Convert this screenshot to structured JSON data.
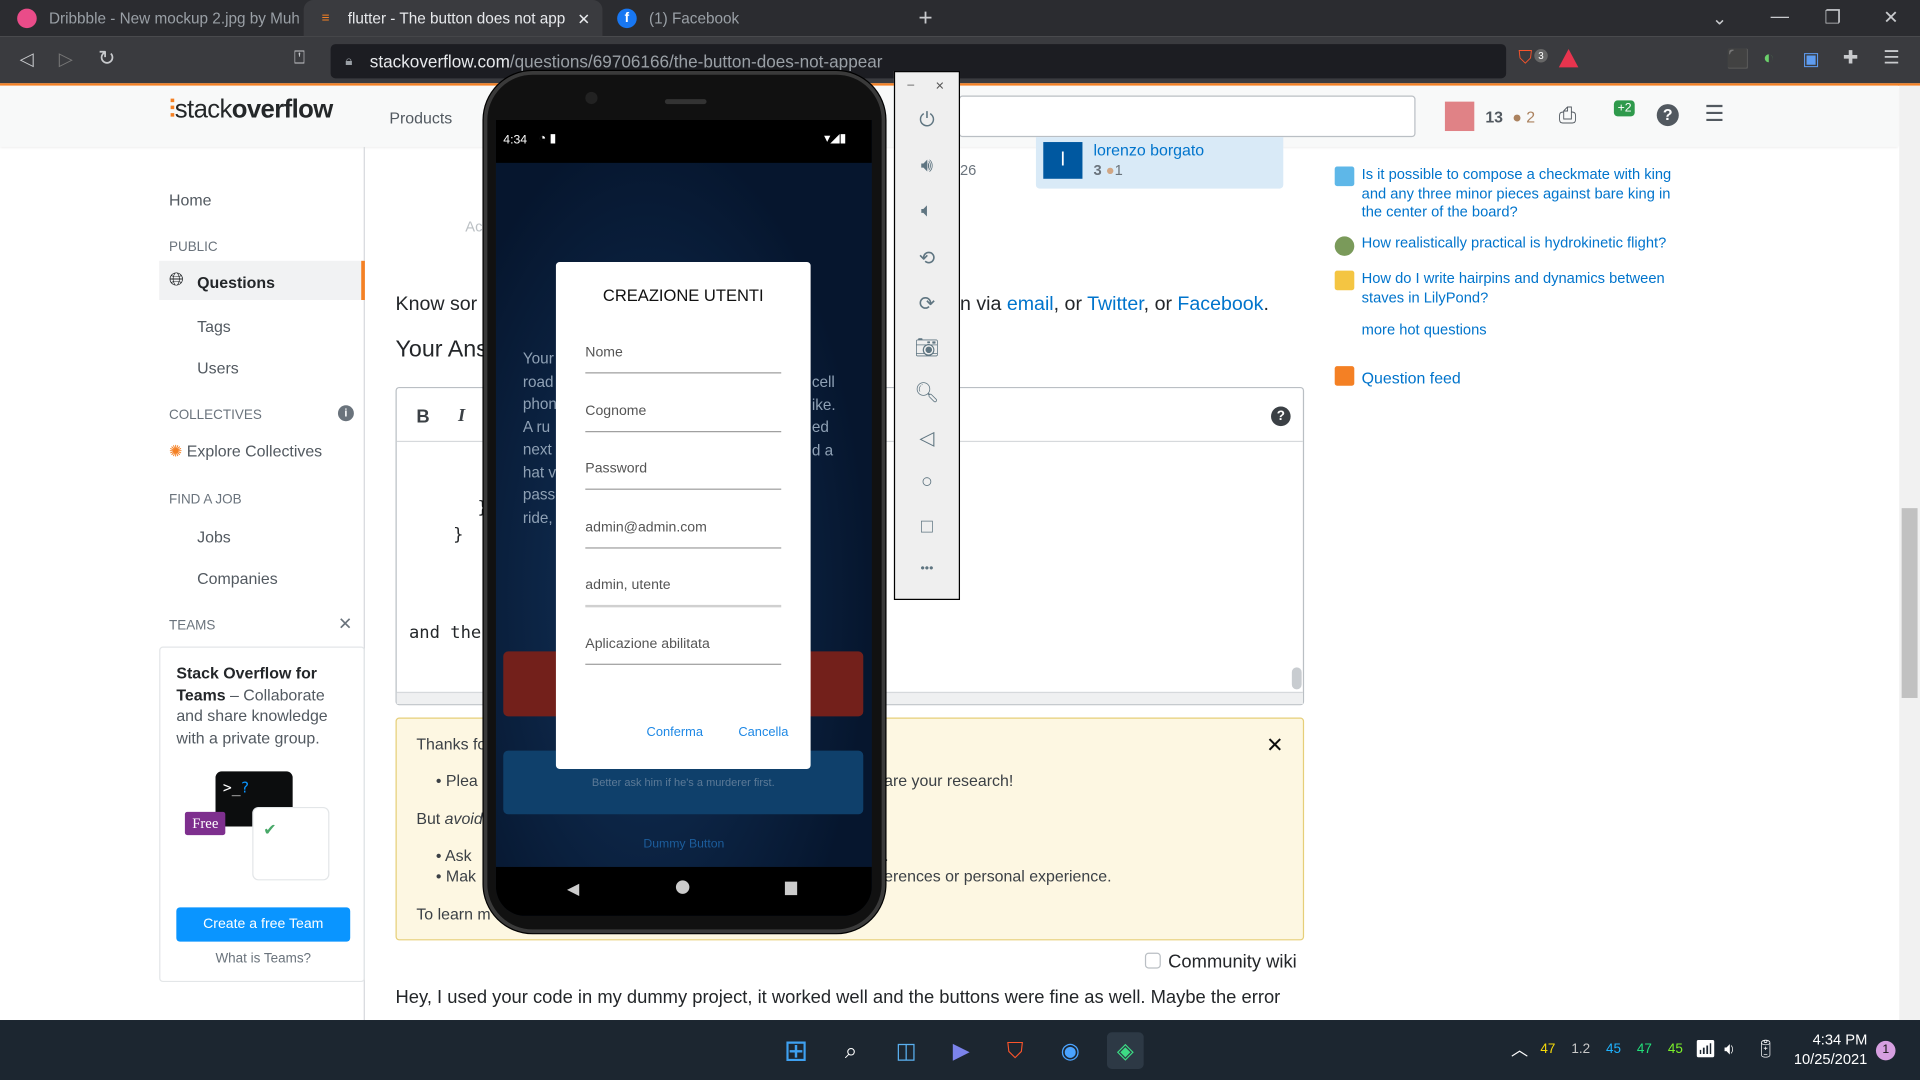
{
  "browser": {
    "tabs": [
      {
        "label": "Dribbble - New mockup 2.jpg by Muh",
        "icon": "dribbble-icon",
        "color": "#ea4c89"
      },
      {
        "label": "flutter - The button does not app",
        "icon": "stackoverflow-icon",
        "active": true
      },
      {
        "label": "(1) Facebook",
        "icon": "facebook-icon",
        "color": "#1877f2"
      }
    ],
    "new_tab": "+",
    "close_tab": "✕",
    "url_host": "stackoverflow.com",
    "url_path": "/questions/69706166/the-button-does-not-appear",
    "brave_badge": "3"
  },
  "so": {
    "logo_a": "stack",
    "logo_b": "overflow",
    "products": "Products",
    "reputation": "13",
    "bronze": "2",
    "review_badge": "+2",
    "sidebar": {
      "home": "Home",
      "public": "PUBLIC",
      "questions": "Questions",
      "tags": "Tags",
      "users": "Users",
      "collectives": "COLLECTIVES",
      "explore": "Explore Collectives",
      "find_job": "FIND A JOB",
      "jobs": "Jobs",
      "companies": "Companies",
      "teams": "TEAMS",
      "teams_title": "Stack Overflow for Teams",
      "teams_desc": " – Collaborate and share knowledge with a private group.",
      "free": "Free",
      "create_team": "Create a free Team",
      "what_is": "What is Teams?"
    },
    "user_card": {
      "initial": "l",
      "name": "lorenzo borgato",
      "rep": "3",
      "bronze": "1"
    },
    "partial_count": "26",
    "partial_ad": "Ac",
    "share_prefix": "Know sor",
    "share_suffix": "n via ",
    "share_email": "email",
    "share_twitter": "Twitter",
    "share_or": ", or ",
    "share_facebook": "Facebook",
    "share_end": ".",
    "your_answer": "Your Ans",
    "editor": {
      "bold": "B",
      "italic": "I",
      "help": "?",
      "code": [
        "}",
        "}"
      ],
      "text": "and the"
    },
    "notice": {
      "thanks": "Thanks fo",
      "bullet1_a": "Plea",
      "bullet1_b": "are your research!",
      "but": "But ",
      "avoid": "avoid",
      "bullet2": "Ask",
      "bullet2_end": ".",
      "bullet3": "Mak",
      "bullet3_b": "erences or personal experience.",
      "learn": "To learn m",
      "close": "✕"
    },
    "community_wiki": "Community wiki",
    "answer_text": "Hey, I used your code in my dummy project, it worked well and the buttons were fine as well. Maybe the error",
    "hot": [
      {
        "text": "Is it possible to compose a checkmate with king and any three minor pieces against bare king in the center of the board?",
        "color": "#5eb7e8"
      },
      {
        "text": "How realistically practical is hydrokinetic flight?",
        "color": "#7a9a5a"
      },
      {
        "text": "How do I write hairpins and dynamics between staves in LilyPond?",
        "color": "#f4c542"
      }
    ],
    "more_hot": "more hot questions",
    "feed": "Question feed"
  },
  "phone": {
    "time": "4:34",
    "bg_text": [
      "Your",
      "road",
      "phon",
      "A ru",
      "next",
      "hat v",
      "pass",
      "ride,"
    ],
    "bg_text_right": [
      "cell",
      "ike.",
      "ed",
      "d a"
    ],
    "dialog": {
      "title": "CREAZIONE UTENTI",
      "fields": [
        "Nome",
        "Cognome",
        "Password",
        "admin@admin.com",
        "admin, utente",
        "Aplicazione abilitata"
      ],
      "confirm": "Conferma",
      "cancel": "Cancella"
    },
    "blue_card_text": "Better ask him if he's a murderer first.",
    "dummy_button": "Dummy Button"
  },
  "emulator": {
    "minimize": "–",
    "close": "×",
    "more": "•••"
  },
  "taskbar": {
    "tray": [
      {
        "v": "47",
        "c": "#f5d90a"
      },
      {
        "v": "1.2",
        "c": "#c8c8c8"
      },
      {
        "v": "45",
        "c": "#1fb3ff"
      },
      {
        "v": "47",
        "c": "#22e07a"
      },
      {
        "v": "45",
        "c": "#7cf02a"
      }
    ],
    "time": "4:34 PM",
    "date": "10/25/2021",
    "notif": "1"
  }
}
